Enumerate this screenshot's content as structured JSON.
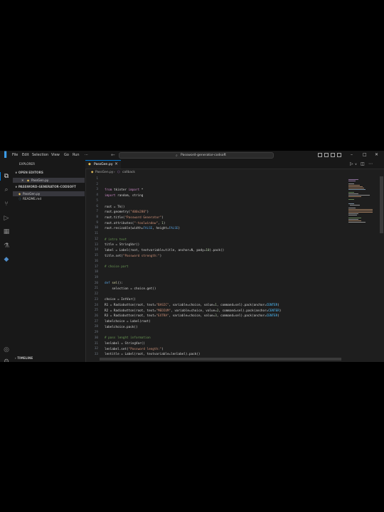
{
  "menu": [
    "File",
    "Edit",
    "Selection",
    "View",
    "Go",
    "Run",
    "···"
  ],
  "command_center": "Password-generator-codsoft",
  "sidebar": {
    "explorer_title": "EXPLORER",
    "open_editors_label": "OPEN EDITORS",
    "open_editor_file": "PassGen.py",
    "project_label": "PASSWORD-GENERATOR-CODSOFT",
    "files": [
      "PassGen.py",
      "README.md"
    ],
    "timeline_label": "TIMELINE"
  },
  "tab": {
    "label": "PassGen.py",
    "close": "×"
  },
  "breadcrumb": {
    "file": "PassGen.py",
    "sep": "›",
    "symbol": "callback"
  },
  "icons": {
    "files": "⧉",
    "search": "⌕",
    "scm": "⑂",
    "run": "▷",
    "extensions": "▦",
    "testing": "⚗",
    "python": "◆",
    "account": "◎",
    "settings": "⚙"
  },
  "code_lines": [
    "1",
    "2",
    "3",
    "4",
    "5",
    "6",
    "7",
    "8",
    "9",
    "10",
    "11",
    "12",
    "13",
    "14",
    "15",
    "16",
    "17",
    "18",
    "19",
    "20",
    "21",
    "22",
    "23",
    "24",
    "25",
    "26",
    "27",
    "28",
    "29",
    "30",
    "31",
    "32",
    "33"
  ],
  "code": {
    "l3": [
      "from",
      " tkinter ",
      "import",
      " *"
    ],
    "l4": [
      "import",
      " random, string"
    ],
    "l6": "root = Tk()",
    "l7": [
      "root.geometry(",
      "\"400x280\"",
      ")"
    ],
    "l8": [
      "root.title(",
      "\"Password Generator\"",
      ")"
    ],
    "l9": [
      "root.attributes(",
      "\"-toolwindow\"",
      ", ",
      "1",
      ")"
    ],
    "l10": [
      "root.resizable(width=",
      "FALSE",
      ", height=",
      "FALSE",
      ")"
    ],
    "l12": "# intro text",
    "l13": "title = StringVar()",
    "l14": [
      "label = Label(root, textvariable=title, anchor=N, pady=",
      "10",
      ").pack()"
    ],
    "l15": [
      "title.set(",
      "\"Password strength:\"",
      ")"
    ],
    "l17": "# choice part",
    "l20": [
      "def",
      " ",
      "sel",
      "():"
    ],
    "l21": "    selection = choice.get()",
    "l23": "choice = IntVar()",
    "l24": [
      "R1 = Radiobutton(root, text=",
      "\"BASIC\"",
      ", variable=choice, value=",
      "1",
      ", command=sel).pack(anchor=",
      "CENTER",
      ")"
    ],
    "l25": [
      "R2 = Radiobutton(root, text=",
      "\"MEDIUM\"",
      ", variable=choice, value=",
      "2",
      ", command=sel).pack(anchor=",
      "CENTER",
      ")"
    ],
    "l26": [
      "R3 = Radiobutton(root, text=",
      "\"EXTRA\"",
      ", variable=choice, value=",
      "3",
      ", command=sel).pack(anchor=",
      "CENTER",
      ")"
    ],
    "l27": "labelchoice = Label(root)",
    "l28": "labelchoice.pack()",
    "l30": "# pass lenght information",
    "l31": "lenlabel = StringVar()",
    "l32": [
      "lenlabel.set(",
      "\"Password length:\"",
      ")"
    ],
    "l33": "lentitle = Label(root, textvariable=lenlabel).pack()"
  },
  "colors": {
    "editor_bg": "#1e1e1e",
    "sidebar_bg": "#181818",
    "accent": "#0078d4",
    "python_icon": "#e8c25a"
  }
}
